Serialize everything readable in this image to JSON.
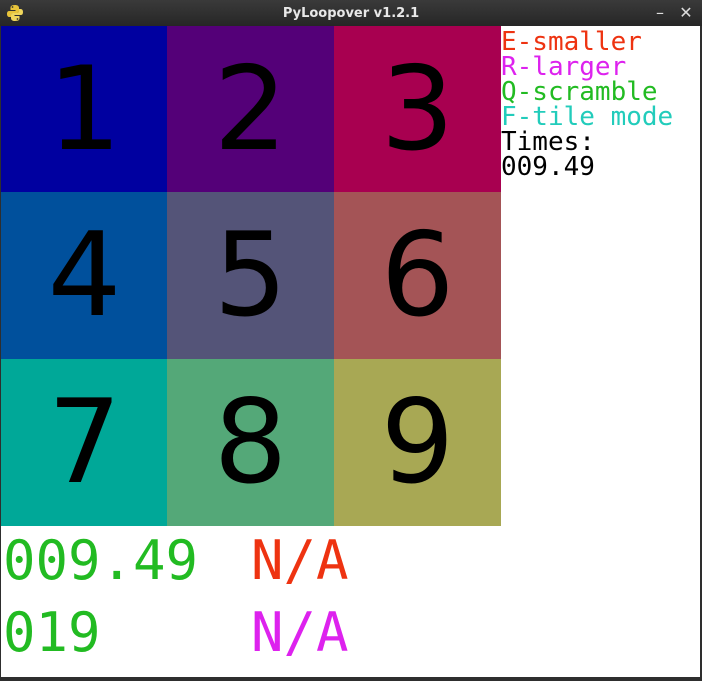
{
  "window": {
    "title": "PyLoopover v1.2.1",
    "minimize_glyph": "–",
    "close_glyph": "✕",
    "icon": "python-logo-icon"
  },
  "board": {
    "tiles": [
      {
        "label": "1",
        "color": "#0000a0"
      },
      {
        "label": "2",
        "color": "#540078"
      },
      {
        "label": "3",
        "color": "#a80050"
      },
      {
        "label": "4",
        "color": "#00509c"
      },
      {
        "label": "5",
        "color": "#545478"
      },
      {
        "label": "6",
        "color": "#a45456"
      },
      {
        "label": "7",
        "color": "#00a898"
      },
      {
        "label": "8",
        "color": "#54a878"
      },
      {
        "label": "9",
        "color": "#a8a854"
      }
    ]
  },
  "help": [
    {
      "text": "E-smaller",
      "color": "#ee3311"
    },
    {
      "text": "R-larger",
      "color": "#dd22ee"
    },
    {
      "text": "Q-scramble",
      "color": "#22bb22"
    },
    {
      "text": "F-tile mode",
      "color": "#22ccbb"
    },
    {
      "text": "Times:",
      "color": "#000000"
    },
    {
      "text": "009.49",
      "color": "#000000"
    }
  ],
  "stats": {
    "time": {
      "text": "009.49",
      "color": "#22bb22"
    },
    "best_time": {
      "text": "N/A",
      "color": "#ee3311"
    },
    "moves": {
      "text": "019",
      "color": "#22bb22"
    },
    "best_moves": {
      "text": "N/A",
      "color": "#dd22ee"
    }
  }
}
